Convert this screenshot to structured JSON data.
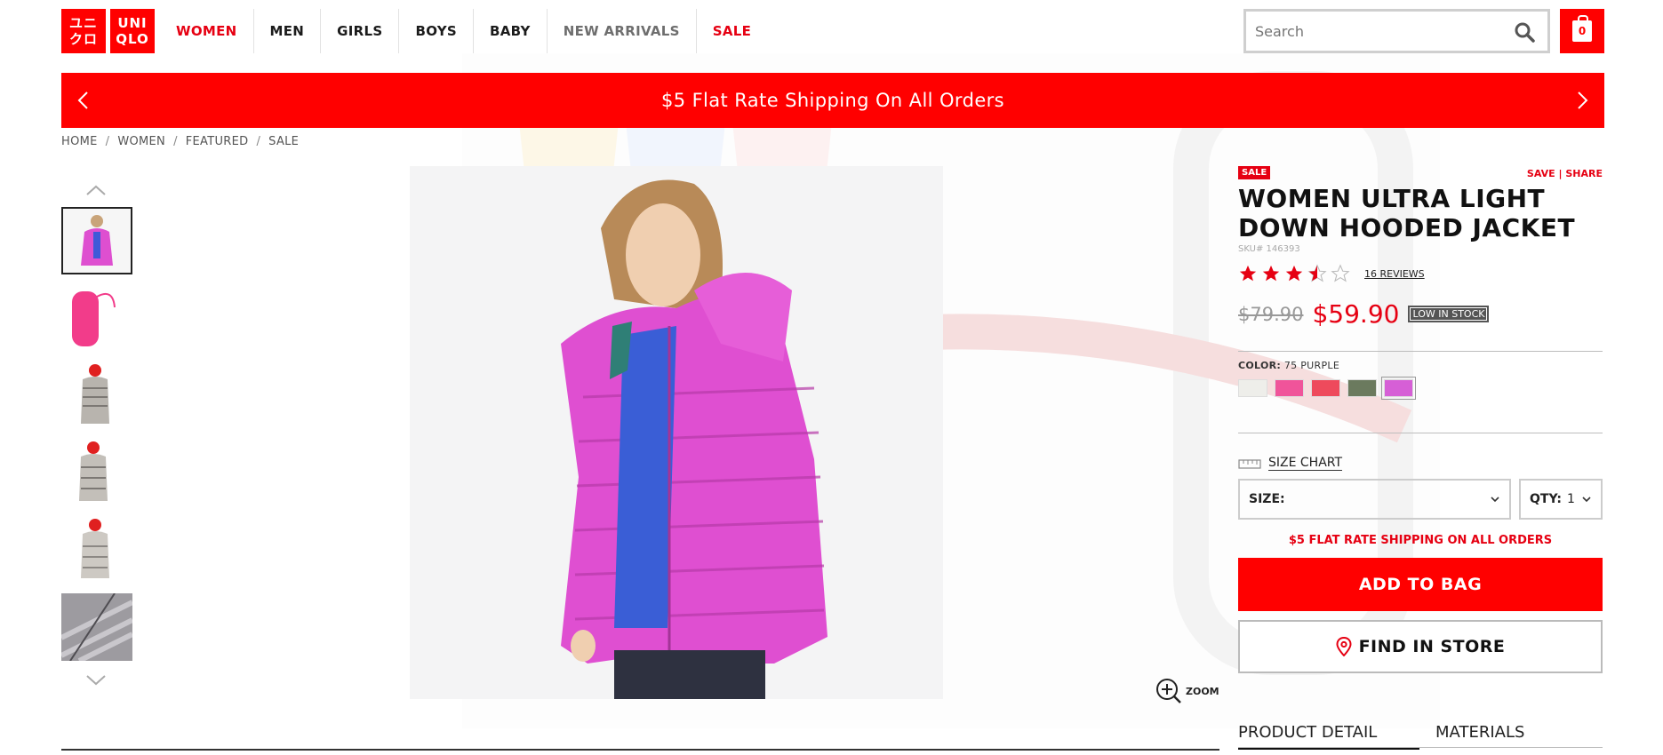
{
  "header": {
    "logo_top": "ユニ\nクロ",
    "logo_left_top": "ユニ",
    "logo_left_bottom": "クロ",
    "logo_right_top": "UNI",
    "logo_right_bottom": "QLO",
    "nav": [
      {
        "label": "WOMEN",
        "style": "red"
      },
      {
        "label": "MEN",
        "style": "normal"
      },
      {
        "label": "GIRLS",
        "style": "normal"
      },
      {
        "label": "BOYS",
        "style": "normal"
      },
      {
        "label": "BABY",
        "style": "normal"
      },
      {
        "label": "NEW ARRIVALS",
        "style": "grey"
      },
      {
        "label": "SALE",
        "style": "red"
      }
    ],
    "search_placeholder": "Search",
    "bag_count": "0"
  },
  "banner": {
    "text": "$5 Flat Rate Shipping On All Orders"
  },
  "breadcrumb": {
    "items": [
      "HOME",
      "WOMEN",
      "FEATURED",
      "SALE"
    ],
    "separator": "/"
  },
  "gallery": {
    "thumbnail_count": 6,
    "zoom_label": "ZOOM"
  },
  "product": {
    "badge": "SALE",
    "save_label": "SAVE",
    "share_label": "SHARE",
    "save_share_separator": "|",
    "title": "WOMEN ULTRA LIGHT DOWN HOODED JACKET",
    "sku": "SKU# 146393",
    "rating": 3.5,
    "rating_max": 5,
    "reviews_label": "16 REVIEWS",
    "old_price": "$79.90",
    "price": "$59.90",
    "stock_label": "LOW IN STOCK",
    "color_label": "COLOR:",
    "color_value": "75 PURPLE",
    "swatches": [
      {
        "name": "off-white",
        "color": "#eeeeea"
      },
      {
        "name": "pink",
        "color": "#f0549a"
      },
      {
        "name": "red",
        "color": "#ee4a5c"
      },
      {
        "name": "olive",
        "color": "#6b7a5e"
      },
      {
        "name": "purple",
        "color": "#d65fd6"
      }
    ],
    "selected_swatch": 4,
    "size_chart_label": "SIZE CHART",
    "size_label": "SIZE:",
    "size_value": "",
    "qty_label": "QTY:",
    "qty_value": "1",
    "shipping_note": "$5 FLAT RATE SHIPPING ON ALL ORDERS",
    "add_to_bag_label": "ADD TO BAG",
    "find_in_store_label": "FIND IN STORE",
    "tabs": [
      "PRODUCT DETAIL",
      "MATERIALS"
    ]
  },
  "colors": {
    "brand_red": "#ff0000",
    "text_red": "#e60012",
    "jacket_pink": "#df4fd1"
  }
}
